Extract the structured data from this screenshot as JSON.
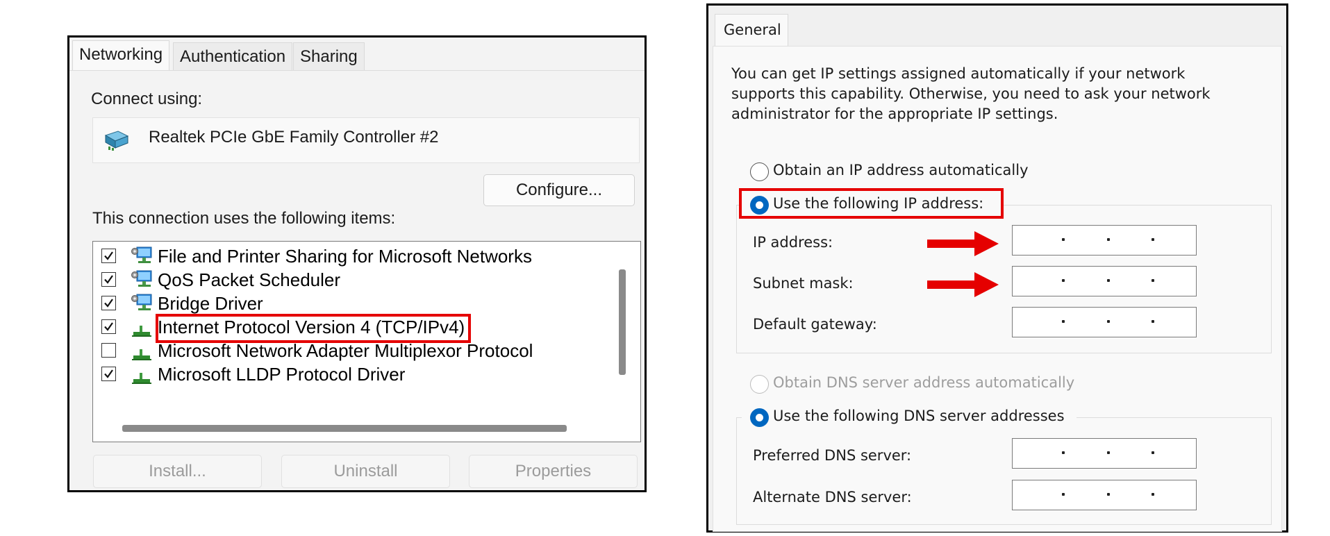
{
  "left_dialog": {
    "tabs": [
      "Networking",
      "Authentication",
      "Sharing"
    ],
    "connect_using_label": "Connect using:",
    "adapter_name": "Realtek PCIe GbE Family Controller #2",
    "adapter_icon": "network-adapter-icon",
    "configure_button": "Configure...",
    "items_label": "This connection uses the following items:",
    "items": [
      {
        "label": "File and Printer Sharing for Microsoft Networks",
        "checked": true,
        "icon": "network-service-icon"
      },
      {
        "label": "QoS Packet Scheduler",
        "checked": true,
        "icon": "network-service-icon"
      },
      {
        "label": "Bridge Driver",
        "checked": true,
        "icon": "network-service-icon"
      },
      {
        "label": "Internet Protocol Version 4 (TCP/IPv4)",
        "checked": true,
        "icon": "protocol-icon",
        "highlighted": true
      },
      {
        "label": "Microsoft Network Adapter Multiplexor Protocol",
        "checked": false,
        "icon": "protocol-icon"
      },
      {
        "label": "Microsoft LLDP Protocol Driver",
        "checked": true,
        "icon": "protocol-icon"
      }
    ],
    "buttons": {
      "install": "Install...",
      "uninstall": "Uninstall",
      "properties": "Properties"
    }
  },
  "right_dialog": {
    "tab": "General",
    "description": [
      "You can get IP settings assigned automatically if your network",
      "supports this capability. Otherwise, you need to ask your network",
      "administrator for the appropriate IP settings."
    ],
    "ip_auto_option": "Obtain an IP address automatically",
    "ip_manual_option": "Use the following IP address:",
    "ip_fields": {
      "ip_address_label": "IP address:",
      "subnet_mask_label": "Subnet mask:",
      "default_gateway_label": "Default gateway:"
    },
    "dns_auto_option": "Obtain DNS server address automatically",
    "dns_manual_option": "Use the following DNS server addresses",
    "dns_fields": {
      "preferred_label": "Preferred DNS server:",
      "alternate_label": "Alternate DNS server:"
    },
    "selected_ip_option": "manual",
    "selected_dns_option": "manual"
  },
  "annotation_color": "#e50000",
  "accent_color": "#0067c0"
}
